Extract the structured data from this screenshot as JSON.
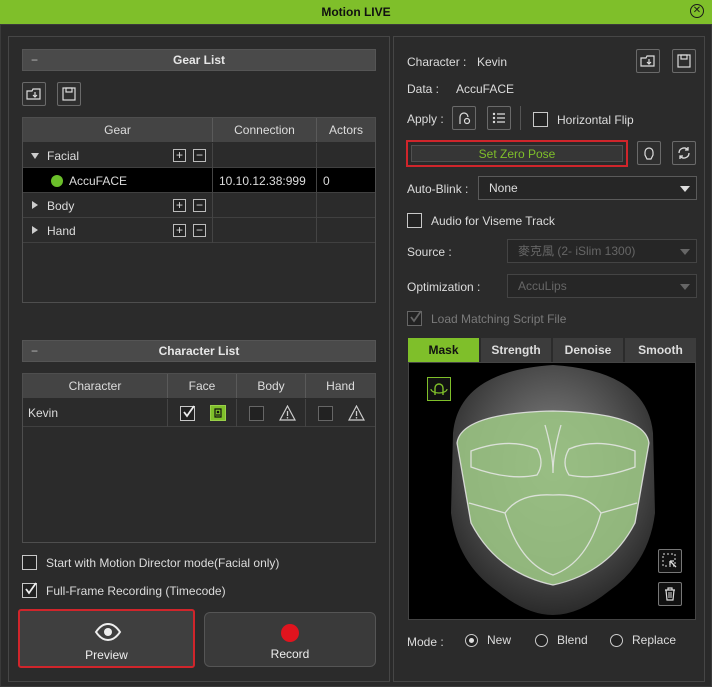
{
  "window": {
    "title": "Motion LIVE"
  },
  "gear_list": {
    "header": "Gear List",
    "columns": [
      "Gear",
      "Connection",
      "Actors"
    ],
    "rows": [
      {
        "name": "Facial",
        "expanded": true
      },
      {
        "name": "AccuFACE",
        "connection": "10.10.12.38:999",
        "actors": "0",
        "status_color": "#6bbf2a"
      },
      {
        "name": "Body",
        "expanded": false
      },
      {
        "name": "Hand",
        "expanded": false
      }
    ]
  },
  "character_list": {
    "header": "Character List",
    "columns": [
      "Character",
      "Face",
      "Body",
      "Hand"
    ],
    "rows": [
      {
        "name": "Kevin"
      }
    ]
  },
  "options": {
    "motion_director": "Start with Motion Director mode(Facial only)",
    "full_frame": "Full-Frame Recording (Timecode)"
  },
  "buttons": {
    "preview": "Preview",
    "record": "Record"
  },
  "right": {
    "character_label": "Character :",
    "character_value": "Kevin",
    "data_label": "Data :",
    "data_value": "AccuFACE",
    "apply_label": "Apply :",
    "horizontal_flip": "Horizontal Flip",
    "set_zero_pose": "Set Zero Pose",
    "auto_blink_label": "Auto-Blink :",
    "auto_blink_value": "None",
    "audio_viseme": "Audio for Viseme Track",
    "source_label": "Source :",
    "source_value": "麥克風 (2- iSlim 1300)",
    "optimization_label": "Optimization :",
    "optimization_value": "AccuLips",
    "load_script": "Load Matching Script File",
    "tabs": [
      "Mask",
      "Strength",
      "Denoise",
      "Smooth"
    ],
    "mode_label": "Mode :",
    "modes": [
      "New",
      "Blend",
      "Replace"
    ],
    "mode_selected": "New"
  },
  "colors": {
    "accent": "#7fbf2a",
    "highlight": "#d0252b",
    "record": "#e0141e"
  }
}
